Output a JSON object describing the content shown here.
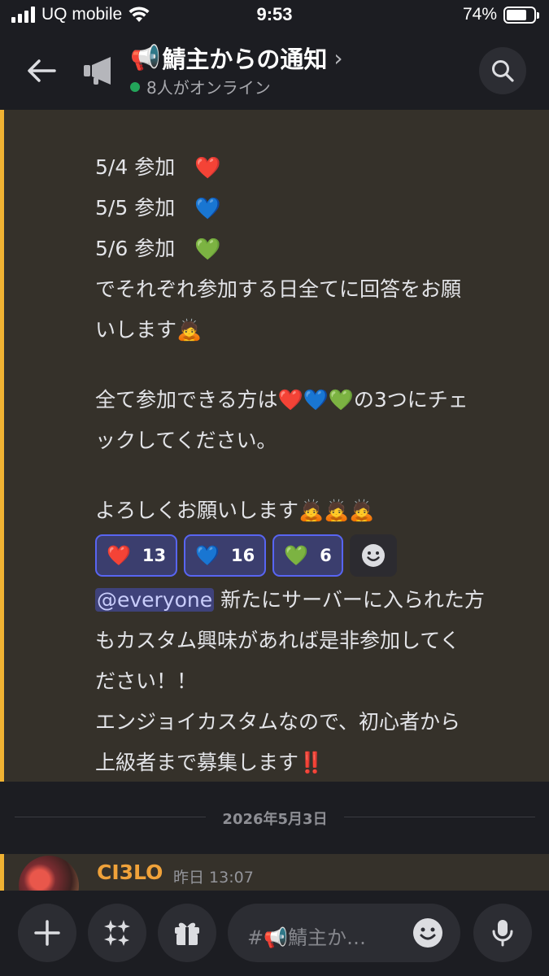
{
  "status_bar": {
    "carrier": "UQ mobile",
    "time": "9:53",
    "battery_percent": "74%",
    "battery_level": 0.74
  },
  "header": {
    "channel_emoji": "📢",
    "channel_name": "鯖主からの通知",
    "chevron": "›",
    "online": "8人がオンライン",
    "online_color": "#23a55a"
  },
  "message": {
    "accent_color": "#f0b232",
    "lines": {
      "d1_date": "5/4",
      "d1_label": "参加",
      "d1_heart": "❤️",
      "d2_date": "5/5",
      "d2_label": "参加",
      "d2_heart": "💙",
      "d3_date": "5/6",
      "d3_label": "参加",
      "d3_heart": "💚",
      "l4": "でそれぞれ参加する日全てに回答をお願",
      "l5": "いします🙇",
      "l6": "全て参加できる方は❤️💙💚の3つにチェ",
      "l7": "ックしてください。",
      "l8": "よろしくお願いします🙇🙇🙇"
    },
    "reactions": [
      {
        "emoji": "❤️",
        "count": "13"
      },
      {
        "emoji": "💙",
        "count": "16"
      },
      {
        "emoji": "💚",
        "count": "6"
      }
    ],
    "mention": "@everyone",
    "followup": {
      "l1": "新たにサーバーに入られた方",
      "l2": "もカスタム興味があれば是非参加してく",
      "l3": "ださい！！",
      "l4": "エンジョイカスタムなので、初心者から",
      "l5": "上級者まで募集します‼️"
    }
  },
  "date_divider": "2026年5月3日",
  "next_message": {
    "author": "CI3LO",
    "time": "昨日 13:07",
    "author_color": "#f0a23a"
  },
  "composer": {
    "placeholder": "#📢鯖主か…"
  }
}
